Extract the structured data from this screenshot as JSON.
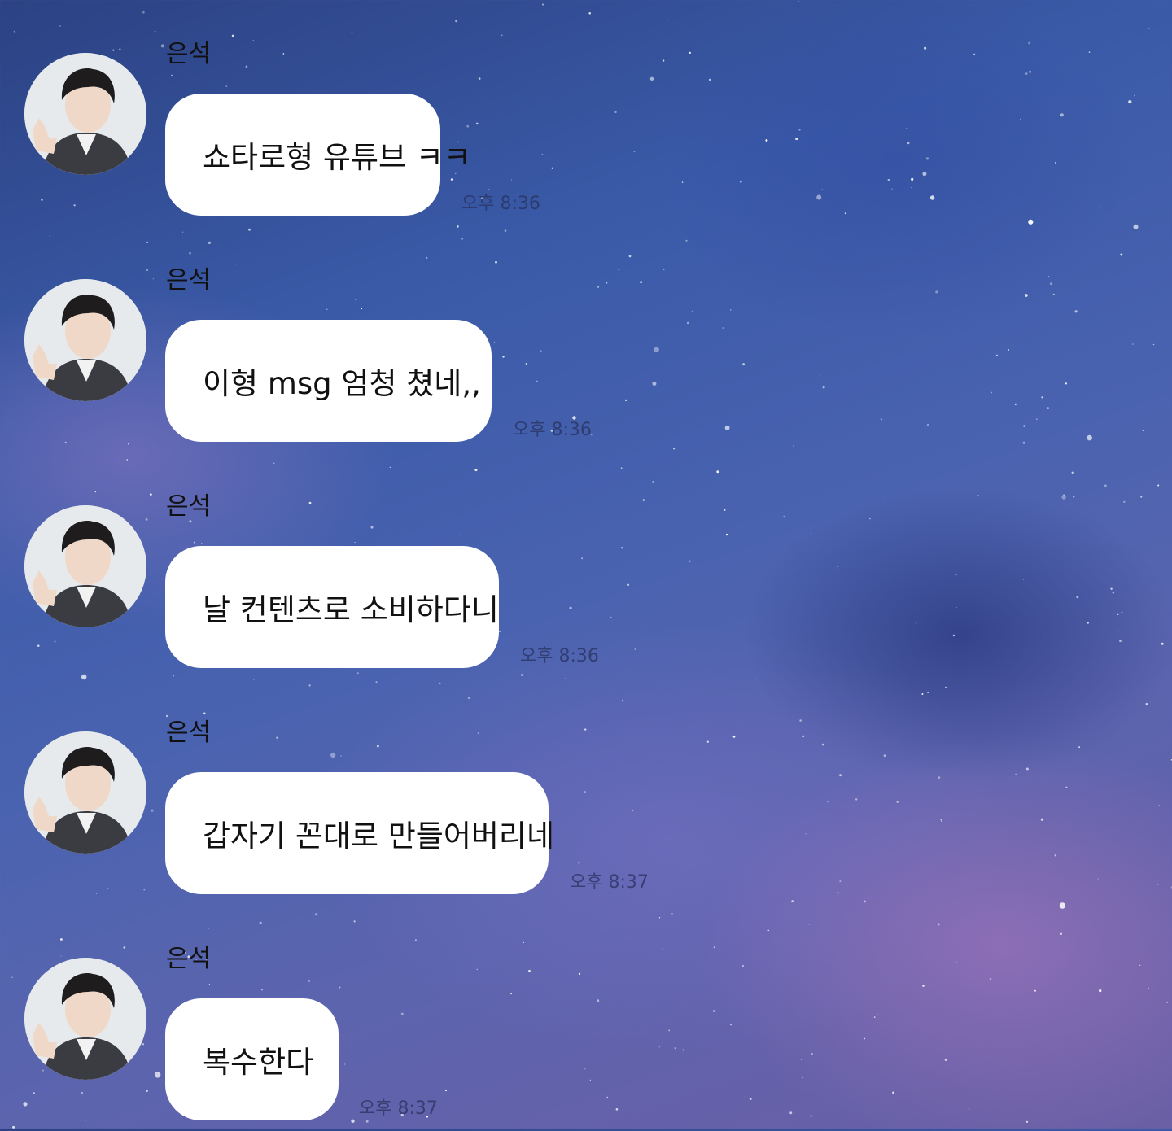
{
  "chat": {
    "messages": [
      {
        "sender": "은석",
        "text": "쇼타로형 유튜브 ㅋㅋ",
        "time": "오후 8:36"
      },
      {
        "sender": "은석",
        "text": "이형 msg 엄청 쳤네,,",
        "time": "오후 8:36"
      },
      {
        "sender": "은석",
        "text": "날 컨텐츠로 소비하다니",
        "time": "오후 8:36"
      },
      {
        "sender": "은석",
        "text": "갑자기 꼰대로 만들어버리네",
        "time": "오후 8:37"
      },
      {
        "sender": "은석",
        "text": "복수한다",
        "time": "오후 8:37"
      }
    ]
  },
  "icons": {
    "avatar": "profile-photo"
  },
  "colors": {
    "bubble": "#ffffff",
    "background": "#3a5aa8",
    "text": "#111111"
  }
}
